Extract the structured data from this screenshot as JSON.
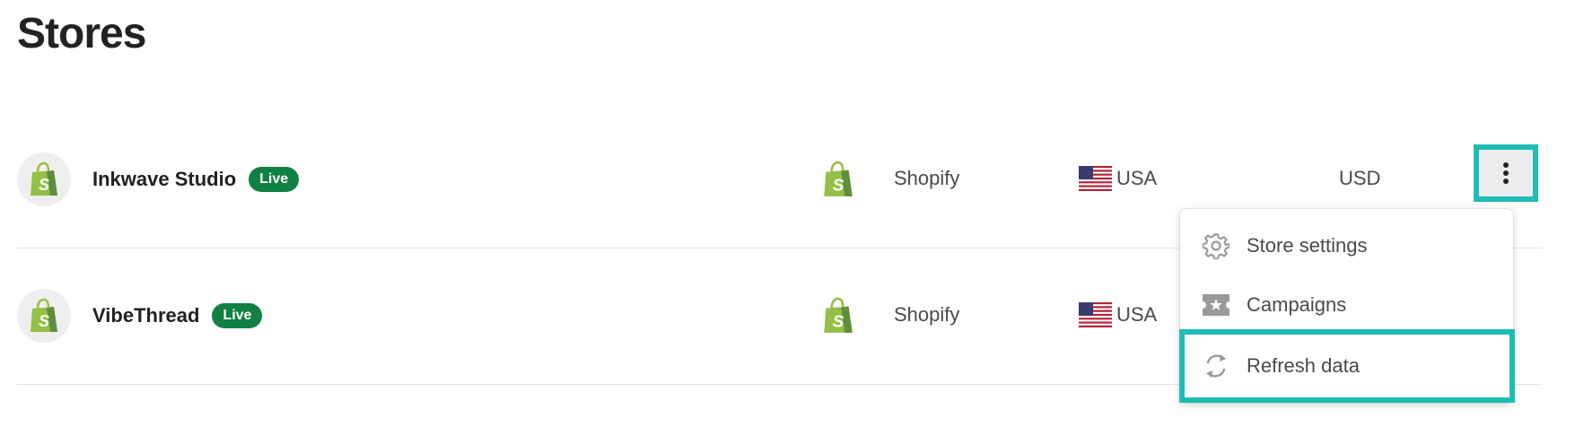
{
  "page": {
    "title": "Stores"
  },
  "stores": [
    {
      "name": "Inkwave Studio",
      "status": "Live",
      "platform": "Shopify",
      "country": "USA",
      "currency": "USD",
      "platform_icon": "shopify-icon",
      "flag_icon": "us-flag-icon"
    },
    {
      "name": "VibeThread",
      "status": "Live",
      "platform": "Shopify",
      "country": "USA",
      "platform_icon": "shopify-icon",
      "flag_icon": "us-flag-icon"
    }
  ],
  "menu": {
    "items": [
      {
        "label": "Store settings",
        "icon": "gear-icon"
      },
      {
        "label": "Campaigns",
        "icon": "ticket-icon"
      },
      {
        "label": "Refresh data",
        "icon": "refresh-icon"
      }
    ]
  },
  "colors": {
    "live_badge": "#108043",
    "highlight": "#1fbcb6",
    "shopify_green": "#95bf47"
  }
}
